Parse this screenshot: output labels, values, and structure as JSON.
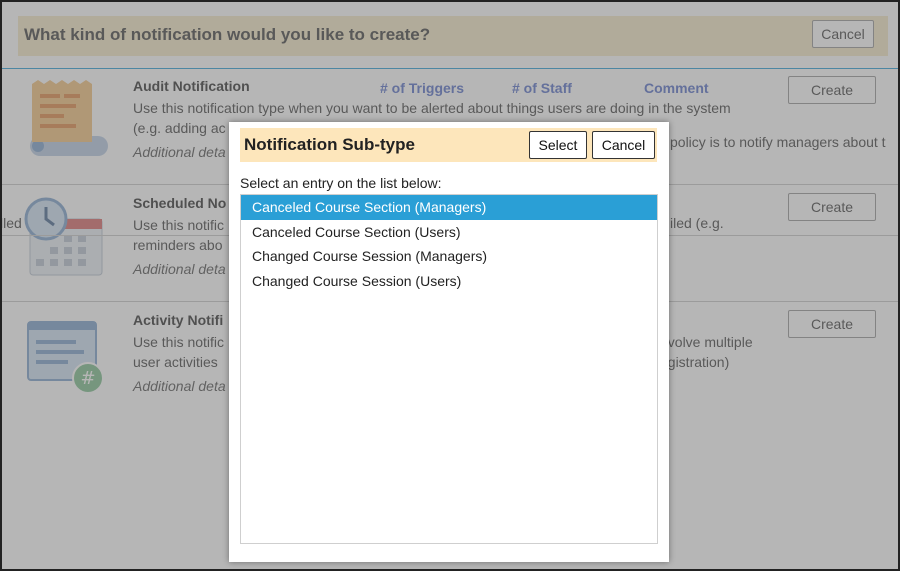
{
  "background": {
    "title": "What kind of notification would you like to create?",
    "cancel_label": "Cancel",
    "columns": [
      "# of Triggers",
      "# of Staff",
      "Comment"
    ],
    "sections": [
      {
        "title": "Audit Notification",
        "desc_line1": "Use this notification type when you want to be alerted about things users are doing in the system",
        "desc_line2": "(e.g. adding ac",
        "more": "Additional deta",
        "create_label": "Create",
        "side_text": "policy is to notify managers about t",
        "icon": "receipt-icon"
      },
      {
        "title": "Scheduled No",
        "desc_line1": "Use this notific",
        "desc_line2": "reminders abo",
        "more": "Additional deta",
        "create_label": "Create",
        "side_text": "iled (e.g.",
        "left_text": "lled",
        "icon": "calendar-clock-icon"
      },
      {
        "title": "Activity Notifi",
        "desc_line1": "Use this notific",
        "desc_line2": "user activities",
        "more": "Additional deta",
        "create_label": "Create",
        "side_line1": "nvolve multiple",
        "side_line2": "egistration)",
        "icon": "document-hash-icon"
      }
    ]
  },
  "dialog": {
    "title": "Notification Sub-type",
    "select_label": "Select",
    "cancel_label": "Cancel",
    "instruction": "Select an entry on the list below:",
    "items": [
      "Canceled Course Section (Managers)",
      "Canceled Course Section (Users)",
      "Changed Course Session (Managers)",
      "Changed Course Session (Users)"
    ],
    "selected_index": 0
  },
  "colors": {
    "accent": "#2a9fd6",
    "dialog_header_bg": "#fde6bb",
    "page_header_bg": "#f5e9c6",
    "column_header": "#5a73c9"
  }
}
